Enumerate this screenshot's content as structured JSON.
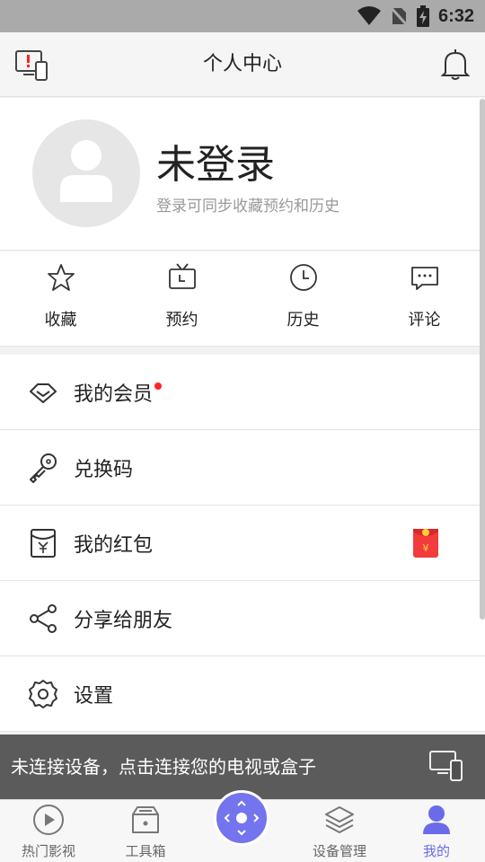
{
  "status_bar": {
    "time": "6:32",
    "icons": [
      "wifi-icon",
      "no-sim-icon",
      "battery-charging-icon"
    ]
  },
  "header": {
    "title": "个人中心",
    "left_icon": "device-alert-icon",
    "right_icon": "bell-icon"
  },
  "profile": {
    "name": "未登录",
    "subtitle": "登录可同步收藏预约和历史"
  },
  "quick_actions": [
    {
      "label": "收藏",
      "icon": "star-icon"
    },
    {
      "label": "预约",
      "icon": "tv-icon"
    },
    {
      "label": "历史",
      "icon": "clock-icon"
    },
    {
      "label": "评论",
      "icon": "comment-icon"
    }
  ],
  "menu": [
    {
      "label": "我的会员",
      "icon": "diamond-icon",
      "badge": "red-dot"
    },
    {
      "label": "兑换码",
      "icon": "key-icon"
    },
    {
      "label": "我的红包",
      "icon": "wallet-icon",
      "trailing_icon": "red-packet-icon"
    },
    {
      "label": "分享给朋友",
      "icon": "share-icon"
    },
    {
      "label": "设置",
      "icon": "settings-icon"
    }
  ],
  "toast": {
    "message": "未连接设备，点击连接您的电视或盒子",
    "icon": "devices-icon"
  },
  "tabs": [
    {
      "label": "热门影视",
      "icon": "play-circle-icon",
      "active": false
    },
    {
      "label": "工具箱",
      "icon": "toolbox-icon",
      "active": false
    },
    {
      "label": "",
      "icon": "remote-control-icon",
      "active": false
    },
    {
      "label": "设备管理",
      "icon": "layers-icon",
      "active": false
    },
    {
      "label": "我的",
      "icon": "user-icon",
      "active": true
    }
  ],
  "colors": {
    "accent": "#6b6bea",
    "badge_red": "#ff2222",
    "status_bar": "#aaaaaa",
    "toast_bg": "#505050"
  }
}
